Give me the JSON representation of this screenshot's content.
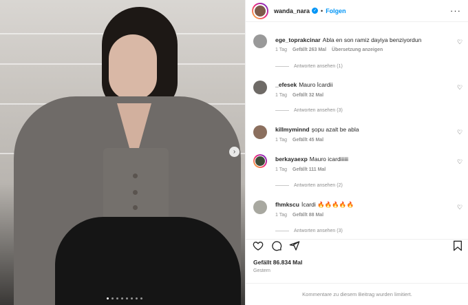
{
  "post": {
    "username": "wanda_nara",
    "follow_label": "Folgen",
    "separator": "•",
    "likes": "Gefällt 86.834 Mal",
    "date": "Gestern",
    "comments_limited": "Kommentare zu diesem Beitrag wurden limitiert."
  },
  "carousel": {
    "slides": 8,
    "active": 0
  },
  "comments": [
    {
      "user": "ege_toprakcinar",
      "text": "Abla en son ramiz dayiya benziyordun",
      "time": "1 Tag",
      "likes": "Gefällt 263 Mal",
      "extra": "Übersetzung anzeigen",
      "replies": "Antworten ansehen (1)"
    },
    {
      "user": "_efesek",
      "text": "Mauro İcardii",
      "time": "1 Tag",
      "likes": "Gefällt 32 Mal",
      "extra": "",
      "replies": "Antworten ansehen (3)"
    },
    {
      "user": "killmyminnd",
      "text": "şopu azalt be abla",
      "time": "1 Tag",
      "likes": "Gefällt 45 Mal",
      "extra": "",
      "replies": ""
    },
    {
      "user": "berkayaexp",
      "text": "Mauro icardiiiiii",
      "time": "1 Tag",
      "likes": "Gefällt 111 Mal",
      "extra": "",
      "replies": "Antworten ansehen (2)"
    },
    {
      "user": "fhmkscu",
      "text": "İcardi 🔥🔥🔥🔥🔥",
      "time": "1 Tag",
      "likes": "Gefällt 88 Mal",
      "extra": "",
      "replies": "Antworten ansehen (3)"
    }
  ],
  "icons": {
    "like": "heart-icon",
    "comment": "comment-icon",
    "share": "share-icon",
    "save": "bookmark-icon",
    "more": "more-icon",
    "verified": "verified-badge-icon",
    "next": "chevron-right-icon"
  }
}
